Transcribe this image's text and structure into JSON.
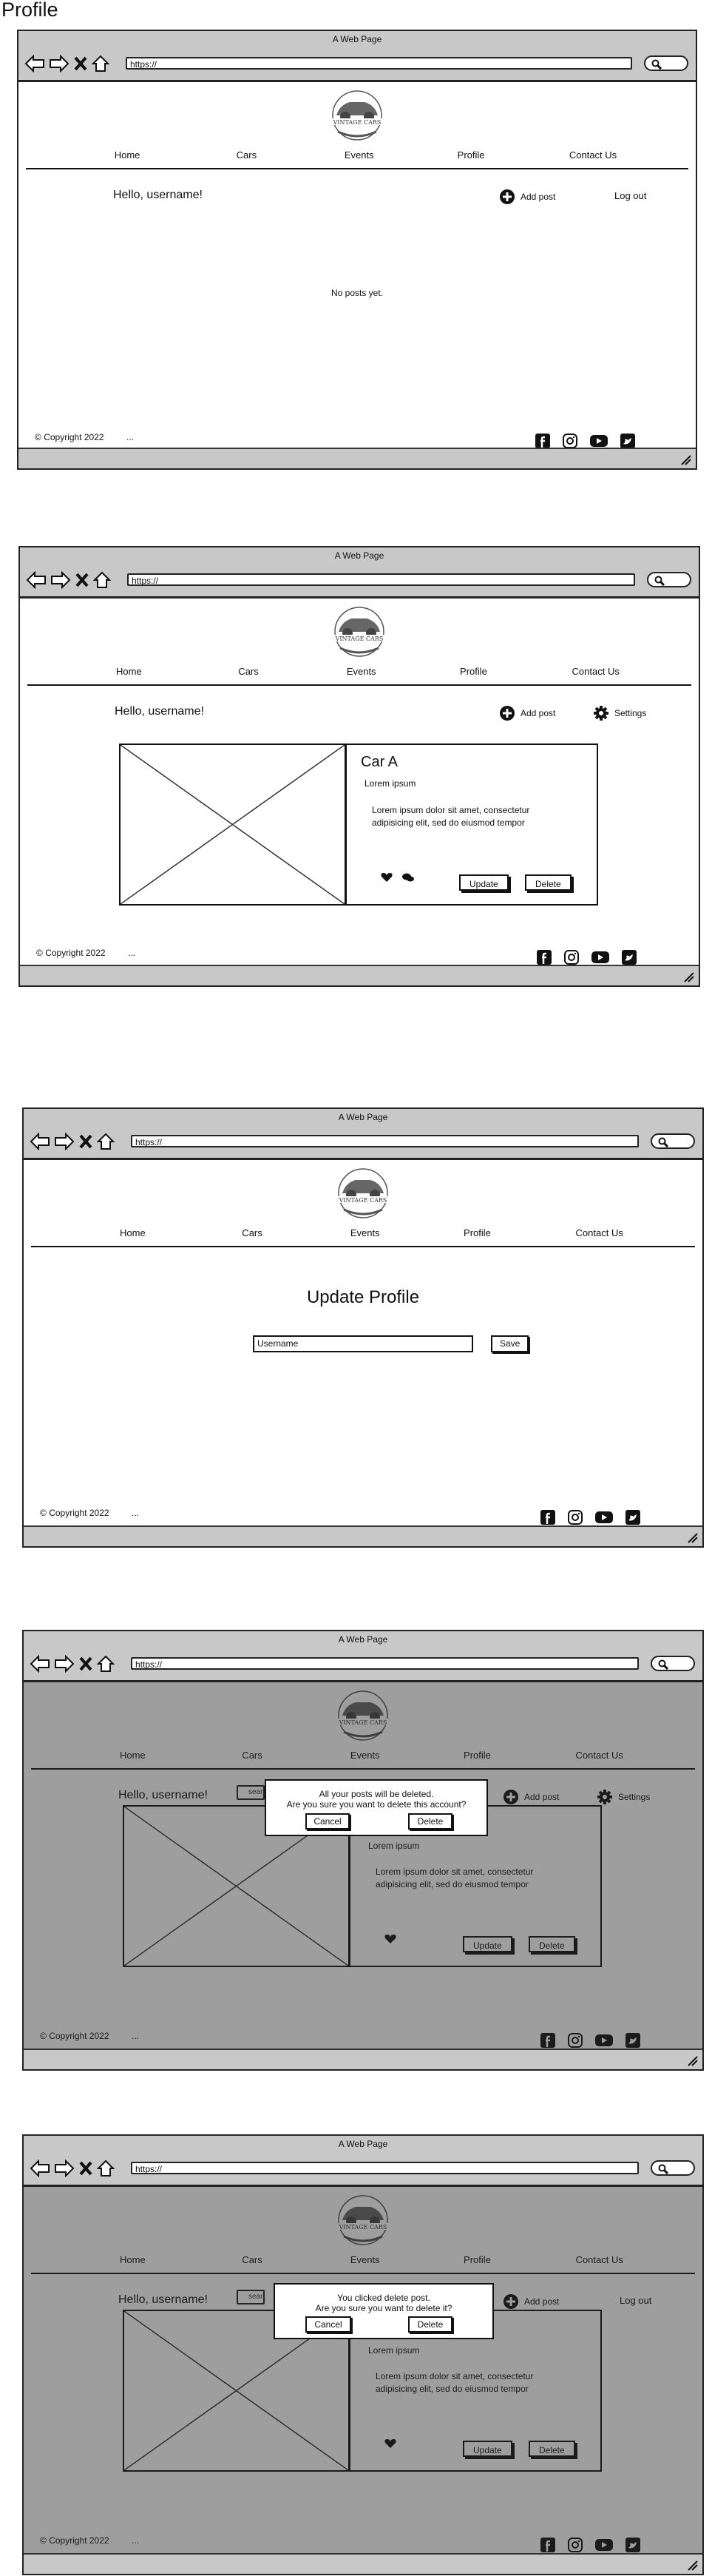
{
  "page_title": "Profile",
  "browser": {
    "title": "A Web Page",
    "url": "https://"
  },
  "site": {
    "logo_text": "VINTAGE CARS",
    "nav": [
      "Home",
      "Cars",
      "Events",
      "Profile",
      "Contact Us"
    ],
    "greeting": "Hello, username!",
    "add_post": "Add post",
    "log_out": "Log out",
    "settings": "Settings",
    "copyright": "Copyright 2022",
    "footer_dots": "...",
    "social": [
      "facebook-icon",
      "instagram-icon",
      "youtube-icon",
      "twitter-icon"
    ]
  },
  "screens": {
    "empty": {
      "no_posts": "No posts yet."
    },
    "post": {
      "title": "Car A",
      "subtitle": "Lorem ipsum",
      "text": "Lorem ipsum dolor sit amet, consectetur adipisicing elit, sed do eiusmod tempor",
      "update": "Update",
      "delete": "Delete"
    },
    "update_profile": {
      "heading": "Update Profile",
      "input_value": "Username",
      "save": "Save"
    },
    "delete_account": {
      "search_placeholder": "sear",
      "line1": "All your posts will be deleted.",
      "line2": "Are you sure you want to delete this account?",
      "cancel": "Cancel",
      "delete": "Delete"
    },
    "delete_post": {
      "search_placeholder": "sear",
      "line1": "You clicked delete post.",
      "line2": "Are you sure you want to delete it?",
      "cancel": "Cancel",
      "delete": "Delete"
    }
  }
}
